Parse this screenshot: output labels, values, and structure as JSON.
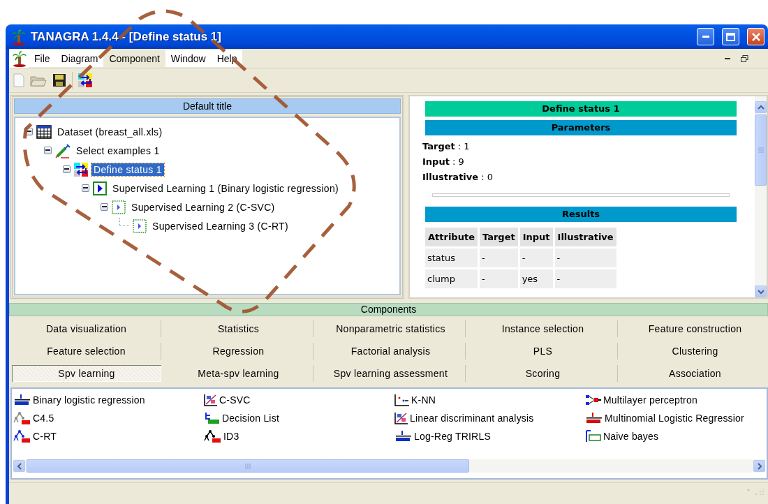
{
  "window": {
    "title": "TANAGRA 1.4.4 - [Define status 1]"
  },
  "menu": [
    {
      "label": "File",
      "selected": false
    },
    {
      "label": "Diagram",
      "selected": false
    },
    {
      "label": "Component",
      "selected": true
    },
    {
      "label": "Window",
      "selected": false
    },
    {
      "label": "Help",
      "selected": false
    }
  ],
  "diagram": {
    "title": "Default title",
    "tree": [
      {
        "label": "Dataset (breast_all.xls)",
        "kind": "dataset",
        "selected": false,
        "expanded": true,
        "children": [
          {
            "label": "Select examples 1",
            "kind": "select",
            "selected": false,
            "expanded": true,
            "children": [
              {
                "label": "Define status 1",
                "kind": "define",
                "selected": true,
                "expanded": true,
                "children": [
                  {
                    "label": "Supervised Learning 1 (Binary logistic regression)",
                    "kind": "learner",
                    "selected": false,
                    "expanded": true,
                    "children": [
                      {
                        "label": "Supervised Learning 2 (C-SVC)",
                        "kind": "learner-dotted",
                        "selected": false,
                        "expanded": true,
                        "children": [
                          {
                            "label": "Supervised Learning 3 (C-RT)",
                            "kind": "learner-dotted",
                            "selected": false
                          }
                        ]
                      }
                    ]
                  }
                ]
              }
            ]
          }
        ]
      }
    ]
  },
  "report": {
    "title": "Define status 1",
    "parameters_title": "Parameters",
    "parameters": [
      {
        "label": "Target",
        "value": ": 1"
      },
      {
        "label": "Input",
        "value": ": 9"
      },
      {
        "label": "Illustrative",
        "value": ": 0"
      }
    ],
    "results_title": "Results",
    "columns": [
      "Attribute",
      "Target",
      "Input",
      "Illustrative"
    ],
    "rows": [
      [
        "status",
        "-",
        "-",
        "-"
      ],
      [
        "clump",
        "-",
        "yes",
        "-"
      ]
    ]
  },
  "components": {
    "title": "Components",
    "tabs": [
      {
        "label": "Data visualization",
        "selected": false
      },
      {
        "label": "Statistics",
        "selected": false
      },
      {
        "label": "Nonparametric statistics",
        "selected": false
      },
      {
        "label": "Instance selection",
        "selected": false
      },
      {
        "label": "Feature construction",
        "selected": false
      },
      {
        "label": "Feature selection",
        "selected": false
      },
      {
        "label": "Regression",
        "selected": false
      },
      {
        "label": "Factorial analysis",
        "selected": false
      },
      {
        "label": "PLS",
        "selected": false
      },
      {
        "label": "Clustering",
        "selected": false
      },
      {
        "label": "Spv learning",
        "selected": true
      },
      {
        "label": "Meta-spv learning",
        "selected": false
      },
      {
        "label": "Spv learning assessment",
        "selected": false
      },
      {
        "label": "Scoring",
        "selected": false
      },
      {
        "label": "Association",
        "selected": false
      }
    ],
    "items": [
      {
        "label": "Binary logistic regression",
        "kind": "logistic"
      },
      {
        "label": "C4.5",
        "kind": "tree-gray"
      },
      {
        "label": "C-RT",
        "kind": "tree-blue"
      },
      {
        "label": "C-SVC",
        "kind": "scatter"
      },
      {
        "label": "Decision List",
        "kind": "decision-list"
      },
      {
        "label": "ID3",
        "kind": "tree-black"
      },
      {
        "label": "K-NN",
        "kind": "knn"
      },
      {
        "label": "Linear discriminant analysis",
        "kind": "scatter"
      },
      {
        "label": "Log-Reg TRIRLS",
        "kind": "logistic"
      },
      {
        "label": "Multilayer perceptron",
        "kind": "perceptron"
      },
      {
        "label": "Multinomial Logistic Regressior",
        "kind": "logistic-red"
      },
      {
        "label": "Naive bayes",
        "kind": "bayes"
      }
    ]
  }
}
